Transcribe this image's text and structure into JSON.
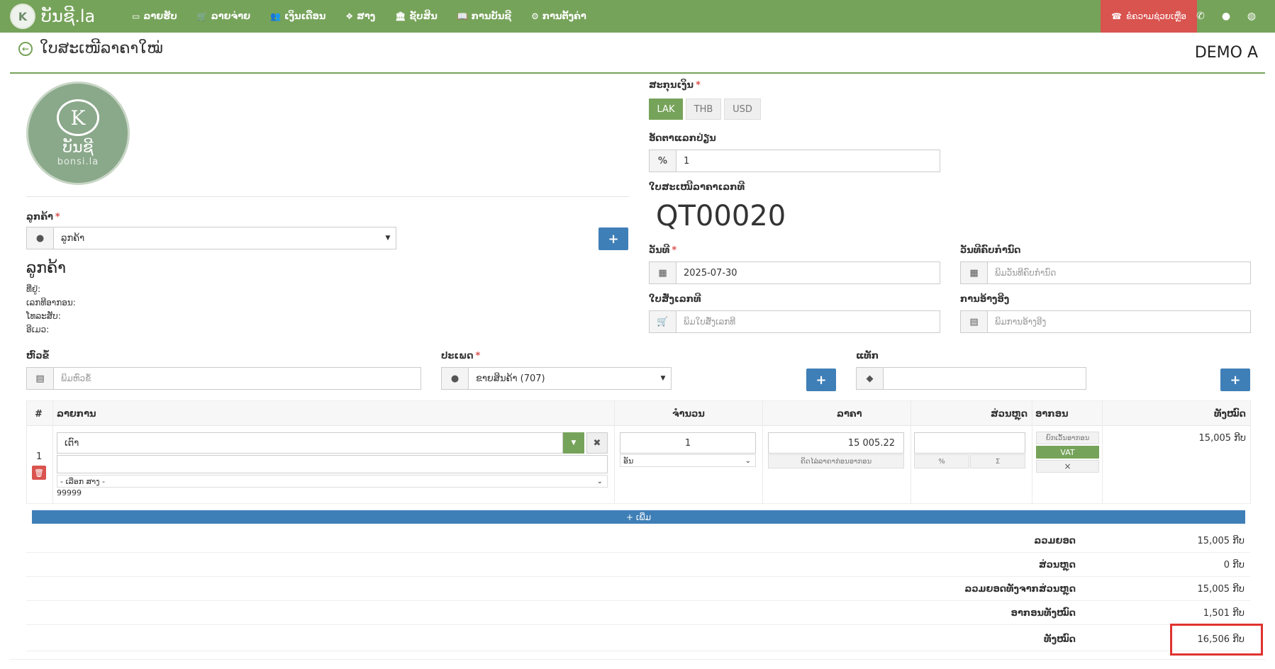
{
  "navbar": {
    "brand": "ບັນຊີ.la",
    "items": [
      {
        "label": "ລາຍຮັບ",
        "icon": "money-icon"
      },
      {
        "label": "ລາຍຈ່າຍ",
        "icon": "cart-icon"
      },
      {
        "label": "ເງິນເດືອນ",
        "icon": "users-icon"
      },
      {
        "label": "ສາງ",
        "icon": "cubes-icon"
      },
      {
        "label": "ຊັບສິນ",
        "icon": "bank-icon"
      },
      {
        "label": "ການບັນຊີ",
        "icon": "book-icon"
      },
      {
        "label": "ການຕັ້ງຄ່າ",
        "icon": "gears-icon"
      }
    ],
    "support_label": "ຂໍຄວາມຊ່ວຍເຫຼືອ"
  },
  "page": {
    "title": "ໃບສະເໜີລາຄາໃໝ່",
    "company": "DEMO A"
  },
  "logo": {
    "name": "ບັນຊີ",
    "sub": "bonsi.la"
  },
  "customer": {
    "label": "ລູກຄ້າ",
    "value": "ລູກຄ້າ",
    "heading": "ລູກຄ້າ",
    "address_label": "ທີ່ຢູ່:",
    "tax_label": "ເລກທີອາກອນ:",
    "phone_label": "ໂທລະສັບ:",
    "email_label": "ອີເມວ:"
  },
  "currency": {
    "label": "ສະກຸນເງິນ",
    "options": [
      "LAK",
      "THB",
      "USD"
    ],
    "selected": "LAK"
  },
  "exchange": {
    "label": "ອັດຕາແລກປ່ຽນ",
    "symbol": "%",
    "value": "1"
  },
  "quote": {
    "label": "ໃບສະເໜີລາຄາເລກທີ",
    "number": "QT00020"
  },
  "date": {
    "label": "ວັນທີ",
    "value": "2025-07-30"
  },
  "due_date": {
    "label": "ວັນທີຄົບກຳນົດ",
    "placeholder": "ພິມວັນທີຄົບກຳນົດ"
  },
  "po": {
    "label": "ໃບສັ່ງເລກທີ",
    "placeholder": "ພິມໃບສັ່ງເລກທີ"
  },
  "reference": {
    "label": "ການອ້າງອີງ",
    "placeholder": "ພິມການອ້າງອີງ"
  },
  "subject": {
    "label": "ຫົວຂໍ້",
    "placeholder": "ພິມຫົວຂໍ້"
  },
  "type": {
    "label": "ປະເພດ",
    "value": "ຂາຍສິນຄ້າ (707)"
  },
  "tags": {
    "label": "ແທັກ"
  },
  "table": {
    "headers": {
      "num": "#",
      "item": "ລາຍການ",
      "qty": "ຈຳນວນ",
      "price": "ລາຄາ",
      "discount": "ສ່ວນຫຼຸດ",
      "tax": "ອາກອນ",
      "total": "ທັງໝົດ"
    },
    "row": {
      "index": "1",
      "item": "ເຕົາ",
      "warehouse": "- ເລືອກ ສາງ -",
      "code": "99999",
      "qty": "1",
      "unit": "ອັນ",
      "price": "15 005.22",
      "price_note": "ຄິດໄລ່ລາຄາກ່ອນອາກອນ",
      "disc_percent": "%",
      "disc_sum": "Σ",
      "tax_exempt": "ຍົກເວັ້ນອາກອນ",
      "tax_vat": "VAT",
      "tax_remove": "×",
      "total": "15,005 ກີບ"
    },
    "add_label": "+ ເພີ່ມ"
  },
  "totals": [
    {
      "label": "ລວມຍອດ",
      "value": "15,005 ກີບ"
    },
    {
      "label": "ສ່ວນຫຼຸດ",
      "value": "0 ກີບ"
    },
    {
      "label": "ລວມຍອດທັງຈາກສ່ວນຫຼຸດ",
      "value": "15,005 ກີບ"
    },
    {
      "label": "ອາກອນທັງໝົດ",
      "value": "1,501 ກີບ"
    },
    {
      "label": "ທັງໝົດ",
      "value": "16,506 ກີບ"
    }
  ],
  "colors": {
    "accent": "#76a35a",
    "primary": "#3f7fb7",
    "danger": "#d9534f"
  }
}
